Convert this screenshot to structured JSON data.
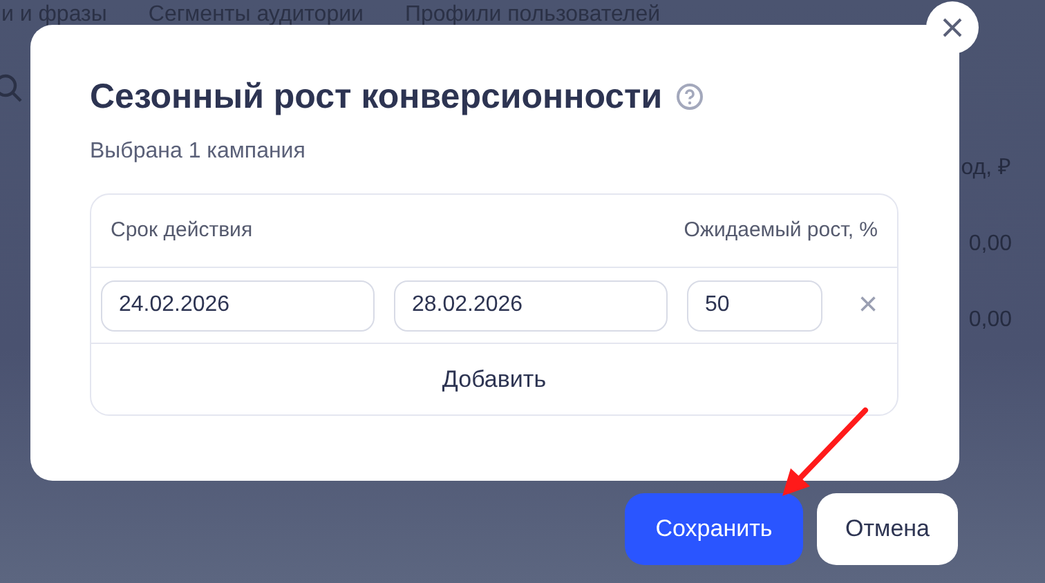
{
  "background": {
    "tabs": [
      "и и фразы",
      "Сегменты аудитории",
      "Профили пользователей"
    ],
    "column_header": "од, ₽",
    "cells": [
      "0,00",
      "0,00"
    ]
  },
  "dialog": {
    "title": "Сезонный рост конверсионности",
    "subtitle": "Выбрана 1 кампания",
    "columns": [
      "Срок действия",
      "Ожидаемый рост, %"
    ],
    "rows": [
      {
        "start": "24.02.2026",
        "end": "28.02.2026",
        "growth": "50",
        "remove": "×"
      }
    ],
    "add_label": "Добавить"
  },
  "buttons": [
    {
      "label": "Сохранить",
      "kind": "primary"
    },
    {
      "label": "Отмена",
      "kind": "secondary"
    }
  ]
}
